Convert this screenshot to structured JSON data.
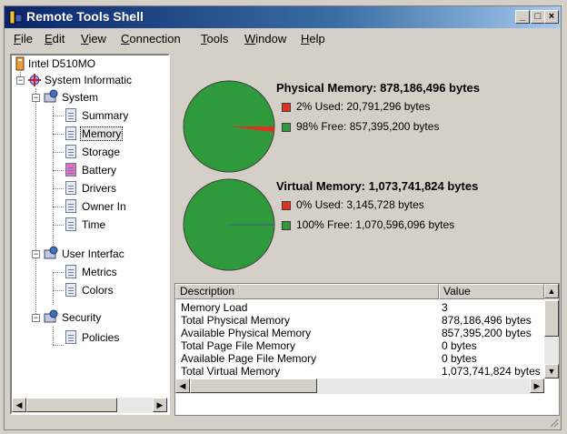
{
  "window": {
    "title": "Remote Tools Shell",
    "min_label": "_",
    "max_label": "□",
    "close_label": "×"
  },
  "menu": [
    {
      "first": "F",
      "rest": "ile"
    },
    {
      "first": "E",
      "rest": "dit"
    },
    {
      "first": "V",
      "rest": "iew"
    },
    {
      "first": "C",
      "rest": "onnection"
    },
    {
      "first": "T",
      "rest": "ools"
    },
    {
      "first": "W",
      "rest": "indow"
    },
    {
      "first": "H",
      "rest": "elp"
    }
  ],
  "tree": {
    "root": "Intel D510MO",
    "system_info": "System Informatic",
    "system": "System",
    "items": [
      "Summary",
      "Memory",
      "Storage",
      "Battery",
      "Drivers",
      "Owner In",
      "Time"
    ],
    "user_interface": "User Interfac",
    "ui_items": [
      "Metrics",
      "Colors"
    ],
    "security": "Security",
    "security_items": [
      "Policies"
    ]
  },
  "physical": {
    "title": "Physical Memory: 878,186,496 bytes",
    "used": "2% Used: 20,791,296 bytes",
    "free": "98% Free: 857,395,200 bytes",
    "used_pct": 2
  },
  "virtual": {
    "title": "Virtual Memory: 1,073,741,824 bytes",
    "used": "0% Used: 3,145,728 bytes",
    "free": "100% Free: 1,070,596,096 bytes",
    "used_pct": 0
  },
  "colors": {
    "used": "#e03020",
    "free": "#2f9a3c"
  },
  "table": {
    "col_desc": "Description",
    "col_value": "Value",
    "rows": [
      {
        "d": "Memory Load",
        "v": "3"
      },
      {
        "d": "Total Physical Memory",
        "v": "878,186,496 bytes"
      },
      {
        "d": "Available Physical Memory",
        "v": "857,395,200 bytes"
      },
      {
        "d": "Total Page File Memory",
        "v": "0 bytes"
      },
      {
        "d": "Available Page File Memory",
        "v": "0 bytes"
      },
      {
        "d": "Total Virtual Memory",
        "v": "1,073,741,824 bytes"
      }
    ]
  }
}
